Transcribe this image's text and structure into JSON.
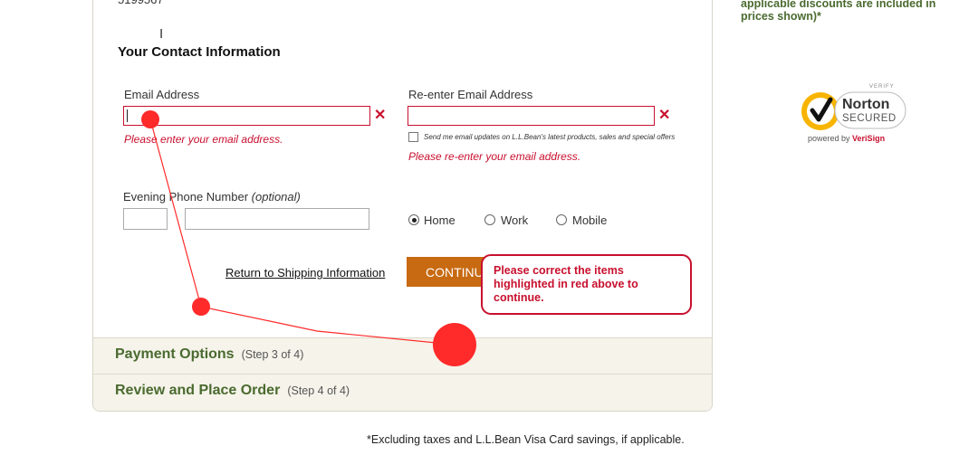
{
  "top_number": "5199567",
  "contact_heading": "Your Contact Information",
  "email": {
    "label": "Email Address",
    "value": "",
    "error": "Please enter your email address."
  },
  "reenter_email": {
    "label": "Re-enter Email Address",
    "value": "",
    "error": "Please re-enter your email address.",
    "updates_checkbox_label": "Send me email updates on L.L.Bean's latest products, sales and special offers"
  },
  "phone": {
    "label": "Evening Phone Number",
    "optional": "(optional)",
    "area_value": "",
    "number_value": ""
  },
  "phone_type": {
    "options": [
      "Home",
      "Work",
      "Mobile"
    ],
    "selected": "Home"
  },
  "return_link": "Return to Shipping Information",
  "continue_button": "CONTINUE",
  "validation_tooltip": "Please correct the items highlighted in red above to continue.",
  "steps": [
    {
      "title": "Payment Options",
      "sub": "(Step 3 of 4)"
    },
    {
      "title": "Review and Place Order",
      "sub": "(Step 4 of 4)"
    }
  ],
  "footnote": "*Excluding taxes and L.L.Bean Visa Card savings, if applicable.",
  "side_note": "applicable discounts are included in prices shown)*",
  "norton": {
    "verify": "VERIFY",
    "brand": "Norton",
    "secured": "SECURED",
    "powered_by": "powered by",
    "verisign": "VeriSign"
  },
  "colors": {
    "error_red": "#c8102e",
    "button_orange": "#c86a12",
    "step_green": "#4a6a2f",
    "norton_yellow": "#f7b400"
  }
}
